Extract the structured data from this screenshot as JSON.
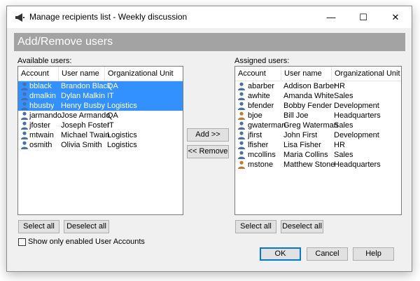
{
  "window": {
    "title": "Manage recipients list - Weekly discussion",
    "min_glyph": "—",
    "max_glyph": "☐",
    "close_glyph": "✕"
  },
  "banner": {
    "text": "Add/Remove users"
  },
  "available": {
    "label": "Available users:",
    "columns": [
      "Account",
      "User name",
      "Organizational Unit"
    ],
    "rows": [
      {
        "account": "bblack",
        "name": "Brandon Black",
        "unit": "QA",
        "selected": true,
        "icon_color": "#4a6fa5"
      },
      {
        "account": "dmalkin",
        "name": "Dylan Malkin",
        "unit": "IT",
        "selected": true,
        "icon_color": "#4a6fa5"
      },
      {
        "account": "hbusby",
        "name": "Henry Busby",
        "unit": "Logistics",
        "selected": true,
        "icon_color": "#4a6fa5"
      },
      {
        "account": "jarmando",
        "name": "Jose Armando",
        "unit": "QA",
        "selected": false,
        "icon_color": "#4a6fa5"
      },
      {
        "account": "jfoster",
        "name": "Joseph Foster",
        "unit": "IT",
        "selected": false,
        "icon_color": "#4a6fa5"
      },
      {
        "account": "mtwain",
        "name": "Michael Twain",
        "unit": "Logistics",
        "selected": false,
        "icon_color": "#4a6fa5"
      },
      {
        "account": "osmith",
        "name": "Olivia Smith",
        "unit": "Logistics",
        "selected": false,
        "icon_color": "#4a6fa5"
      }
    ],
    "select_all": "Select all",
    "deselect_all": "Deselect all"
  },
  "assigned": {
    "label": "Assigned users:",
    "columns": [
      "Account",
      "User name",
      "Organizational Unit"
    ],
    "rows": [
      {
        "account": "abarber",
        "name": "Addison Barber",
        "unit": "HR",
        "icon_color": "#4a6fa5"
      },
      {
        "account": "awhite",
        "name": "Amanda White",
        "unit": "Sales",
        "icon_color": "#4a6fa5"
      },
      {
        "account": "bfender",
        "name": "Bobby Fender",
        "unit": "Development",
        "icon_color": "#4a6fa5"
      },
      {
        "account": "bjoe",
        "name": "Bill Joe",
        "unit": "Headquarters",
        "icon_color": "#c07a30"
      },
      {
        "account": "gwaterman",
        "name": "Greg Waterman",
        "unit": "Sales",
        "icon_color": "#4a6fa5"
      },
      {
        "account": "jfirst",
        "name": "John First",
        "unit": "Development",
        "icon_color": "#4a6fa5"
      },
      {
        "account": "lfisher",
        "name": "Lisa Fisher",
        "unit": "HR",
        "icon_color": "#4a6fa5"
      },
      {
        "account": "mcollins",
        "name": "Maria Collins",
        "unit": "Sales",
        "icon_color": "#4a6fa5"
      },
      {
        "account": "mstone",
        "name": "Matthew Stone",
        "unit": "Headquarters",
        "icon_color": "#c07a30"
      }
    ],
    "select_all": "Select all",
    "deselect_all": "Deselect all"
  },
  "transfer": {
    "add": "Add >>",
    "remove": "<< Remove"
  },
  "options": {
    "show_enabled_label": "Show only enabled User Accounts",
    "show_enabled_checked": false
  },
  "footer": {
    "ok": "OK",
    "cancel": "Cancel",
    "help": "Help"
  },
  "colors": {
    "selection": "#3390ff",
    "banner": "#a3a3a3"
  }
}
